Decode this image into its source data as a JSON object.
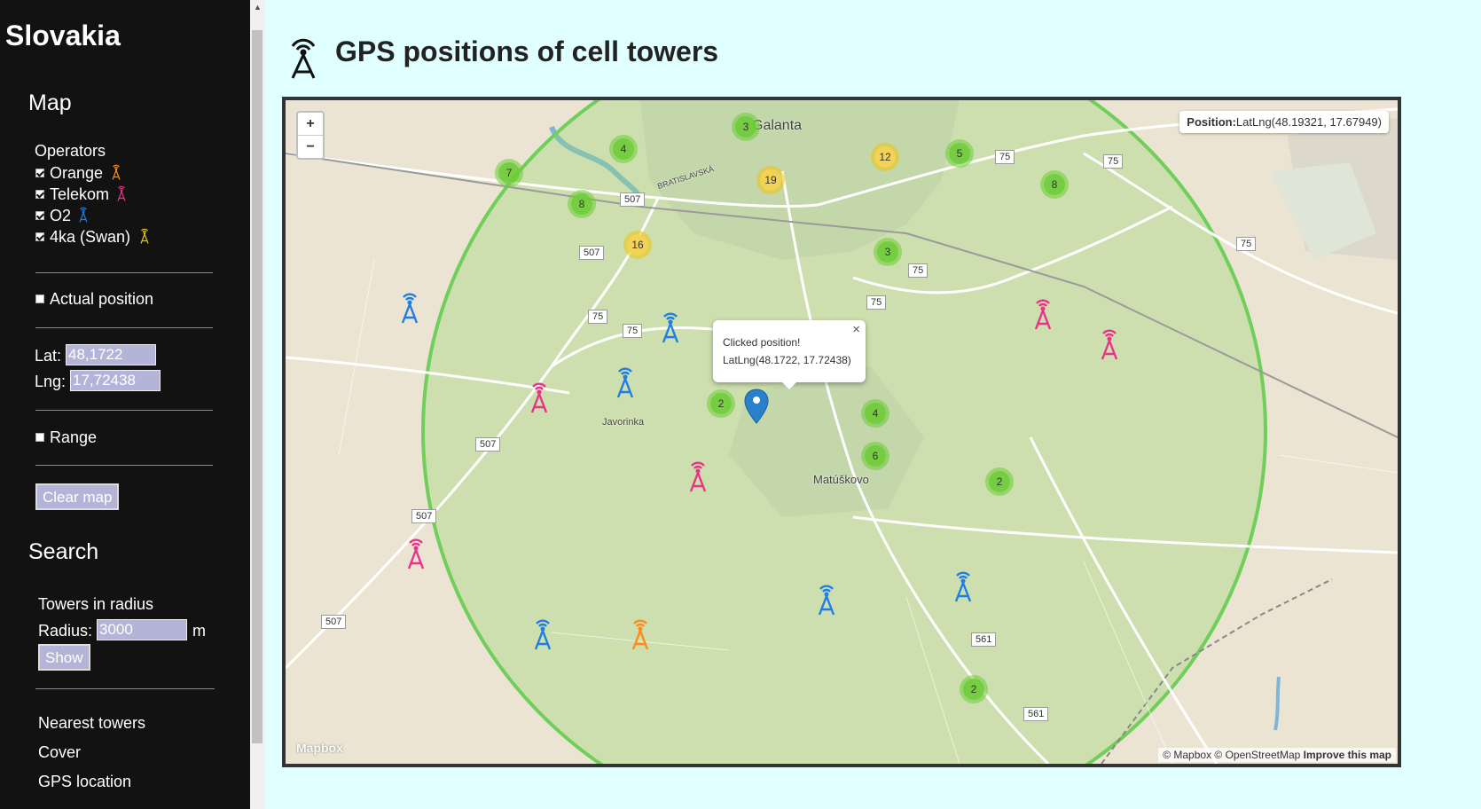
{
  "sidebar": {
    "country": "Slovakia",
    "map_heading": "Map",
    "operators_label": "Operators",
    "operators": [
      {
        "label": "Orange",
        "checked": true,
        "color": "#ff8c1a",
        "icon": "tower-icon"
      },
      {
        "label": "Telekom",
        "checked": true,
        "color": "#e8338b",
        "icon": "tower-icon"
      },
      {
        "label": "O2",
        "checked": true,
        "color": "#1e7ee6",
        "icon": "tower-icon"
      },
      {
        "label": "4ka (Swan)",
        "checked": true,
        "color": "#e6c117",
        "icon": "tower-icon"
      }
    ],
    "actual_position": {
      "label": "Actual position",
      "checked": false
    },
    "lat_label": "Lat:",
    "lat_value": "48,1722",
    "lng_label": "Lng:",
    "lng_value": "17,72438",
    "range": {
      "label": "Range",
      "checked": false
    },
    "clear_map": "Clear map",
    "search_heading": "Search",
    "towers_in_radius": "Towers in radius",
    "radius_label": "Radius:",
    "radius_value": "3000",
    "radius_unit": "m",
    "show_button": "Show",
    "links": [
      "Nearest towers",
      "Cover",
      "GPS location"
    ]
  },
  "header": {
    "title": "GPS positions of cell towers",
    "icon": "antenna-icon"
  },
  "map": {
    "zoom_in": "+",
    "zoom_out": "−",
    "position_label": "Position:",
    "position_value": "LatLng(48.19321, 17.67949)",
    "popup_title": "Clicked position!",
    "popup_text": "LatLng(48.1722, 17.72438)",
    "popup_close": "×",
    "attribution_1": "© Mapbox © OpenStreetMap ",
    "attribution_2": "Improve this map",
    "logo": "Mapbox",
    "places": {
      "galanta": "Galanta",
      "matuskovo": "Matúškovo",
      "javorinka": "Javorinka",
      "bratislavska": "BRATISLAVSKÁ"
    },
    "road_labels": [
      "507",
      "507",
      "507",
      "507",
      "507",
      "75",
      "75",
      "75",
      "75",
      "75",
      "75",
      "75",
      "561",
      "561"
    ],
    "clusters": {
      "c1": "3",
      "c2": "4",
      "c3": "7",
      "c4": "8",
      "c5": "19",
      "c6": "12",
      "c7": "5",
      "c8": "8",
      "c9": "16",
      "c10": "3",
      "c11": "2",
      "c12": "4",
      "c13": "6",
      "c14": "2",
      "c15": "2"
    },
    "colors": {
      "orange": "#ff8c1a",
      "telekom": "#e8338b",
      "o2": "#1e7ee6",
      "swan": "#e6c117",
      "range_circle": "#6fcf5a",
      "sidebar_bg": "#121212",
      "page_bg": "#e0ffff"
    }
  }
}
